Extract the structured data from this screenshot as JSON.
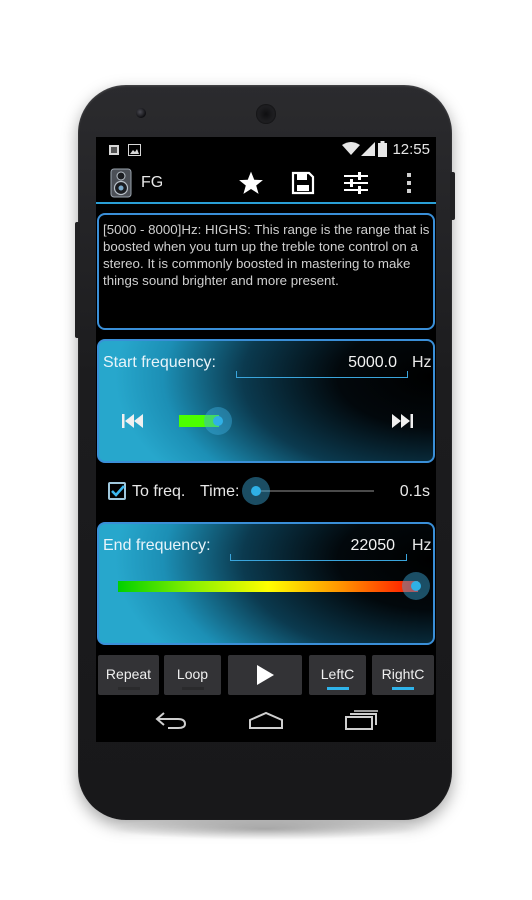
{
  "status_bar": {
    "time": "12:55"
  },
  "action_bar": {
    "title": "FG",
    "icons": [
      "app-logo-icon",
      "star-icon",
      "save-icon",
      "equalizer-icon",
      "overflow-menu-icon"
    ]
  },
  "description": "[5000 - 8000]Hz: HIGHS: This range is the range that is boosted when you turn up the treble tone control on a stereo. It is commonly boosted in mastering to make things sound brighter and more present.",
  "start_frequency": {
    "label": "Start frequency:",
    "value": "5000.0",
    "unit": "Hz",
    "slider_fraction": 0.22
  },
  "sweep": {
    "to_freq_label": "To freq.",
    "to_freq_checked": true,
    "time_label": "Time:",
    "time_value": "0.1s",
    "time_slider_fraction": 0.0
  },
  "end_frequency": {
    "label": "End frequency:",
    "value": "22050",
    "unit": "Hz",
    "slider_fraction": 1.0
  },
  "buttons": {
    "repeat": "Repeat",
    "loop": "Loop",
    "left_channel": "LeftC",
    "right_channel": "RightC"
  },
  "colors": {
    "accent": "#2fb3ea",
    "panel_border": "#3a8fd8",
    "active_indicator": "#2fb3ea"
  }
}
